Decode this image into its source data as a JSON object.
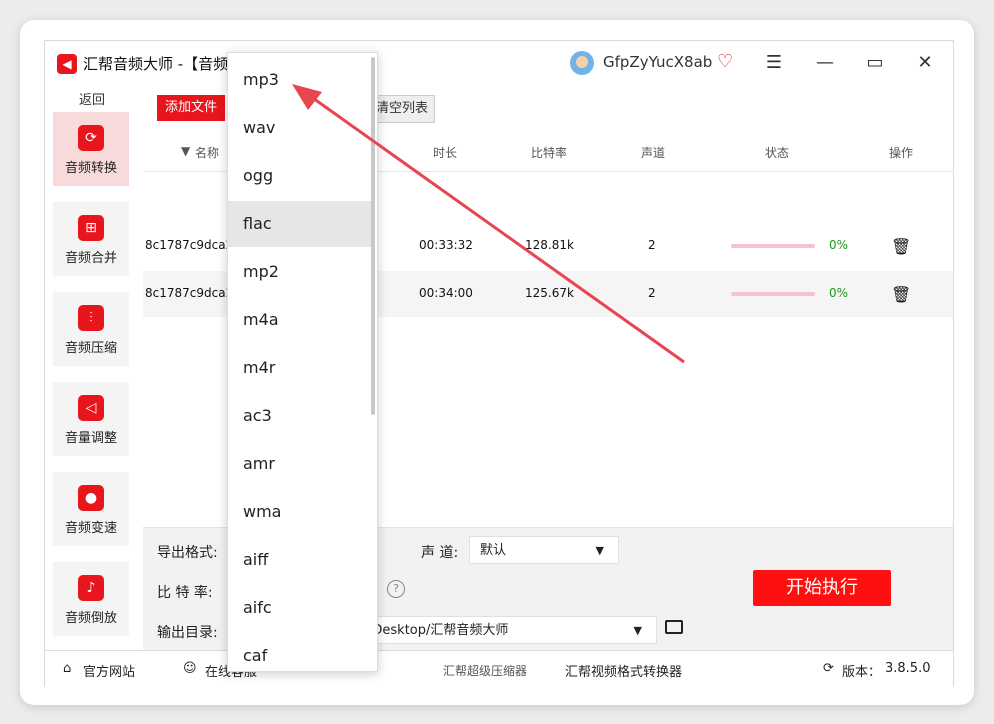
{
  "app": {
    "title": "汇帮音频大师  -【音频转换】",
    "user_name": "GfpZyYucX8ab"
  },
  "window_controls": {
    "menu": "☰",
    "minimize": "—",
    "maximize": "▭",
    "close": "✕"
  },
  "sidebar": {
    "back_label": "返回",
    "items": [
      {
        "label": "音频转换",
        "icon": "audio-convert-icon"
      },
      {
        "label": "音频合并",
        "icon": "audio-merge-icon"
      },
      {
        "label": "音频压缩",
        "icon": "audio-compress-icon"
      },
      {
        "label": "音量调整",
        "icon": "volume-icon"
      },
      {
        "label": "音频变速",
        "icon": "mic-icon"
      },
      {
        "label": "音频倒放",
        "icon": "music-note-icon"
      }
    ]
  },
  "toolbar": {
    "add_files": "添加文件",
    "clear_list": "清空列表"
  },
  "table": {
    "columns": {
      "name": "名称",
      "duration": "时长",
      "bitrate": "比特率",
      "channels": "声道",
      "status": "状态",
      "actions": "操作"
    },
    "rows": [
      {
        "name": "8c1787c9dca2",
        "duration": "00:33:32",
        "bitrate": "128.81k",
        "channels": "2",
        "progress": 0,
        "progress_label": "0%"
      },
      {
        "name": "8c1787c9dca2",
        "duration": "00:34:00",
        "bitrate": "125.67k",
        "channels": "2",
        "progress": 0,
        "progress_label": "0%"
      }
    ]
  },
  "settings": {
    "export_format_label": "导出格式:",
    "channel_label": "声 道:",
    "channel_value": "默认",
    "bitrate_label": "比 特 率:",
    "output_dir_label": "输出目录:",
    "output_dir_value": "/Desktop/汇帮音频大师",
    "help": "?",
    "start_button": "开始执行"
  },
  "format_dropdown": {
    "options": [
      "mp3",
      "wav",
      "ogg",
      "flac",
      "mp2",
      "m4a",
      "m4r",
      "ac3",
      "amr",
      "wma",
      "aiff",
      "aifc",
      "caf"
    ],
    "highlighted": "flac"
  },
  "footer": {
    "website": "官方网站",
    "online_service": "在线客服",
    "link_compressor": "汇帮超级压缩器",
    "link_video_converter": "汇帮视频格式转换器",
    "version_label": "版本：",
    "version_value": "3.8.5.0"
  },
  "colors": {
    "brand_red": "#e8151d",
    "progress_green": "#1a9a1a",
    "annotation_arrow": "#e8454f"
  }
}
